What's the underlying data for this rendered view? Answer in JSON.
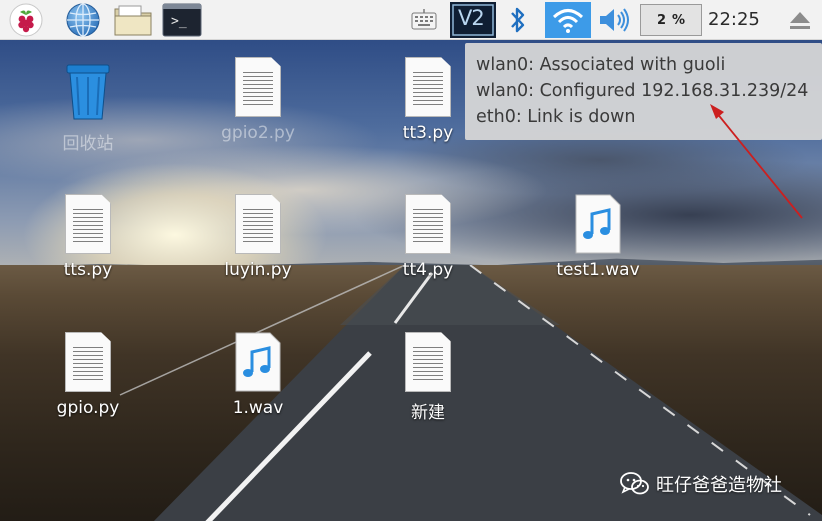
{
  "panel": {
    "menu_icon": "raspberry-icon",
    "browser_icon": "globe-icon",
    "files_icon": "folder-icon",
    "terminal_icon": "terminal-icon",
    "terminal_prompt": ">_",
    "keyboard_icon": "keyboard-icon",
    "vnc_icon": "vnc-icon",
    "vnc_label": "V2",
    "bluetooth_icon": "bluetooth-icon",
    "wifi_icon": "wifi-icon",
    "volume_icon": "speaker-icon",
    "cpu_value": "2",
    "cpu_unit": "%",
    "clock": "22:25",
    "eject_icon": "eject-icon"
  },
  "network_tooltip": {
    "lines": [
      "wlan0: Associated with guoli",
      "wlan0: Configured 192.168.31.239/24",
      "eth0: Link is down"
    ]
  },
  "desktop_icons": [
    {
      "label": "回收站",
      "type": "trash",
      "obscured": true
    },
    {
      "label": "gpio2.py",
      "type": "python-file",
      "obscured": true
    },
    {
      "label": "tt3.py",
      "type": "python-file",
      "obscured": false
    },
    {
      "label": "tts.py",
      "type": "python-file",
      "obscured": false
    },
    {
      "label": "luyin.py",
      "type": "python-file",
      "obscured": false
    },
    {
      "label": "tt4.py",
      "type": "python-file",
      "obscured": false
    },
    {
      "label": "test1.wav",
      "type": "audio-file",
      "obscured": false
    },
    {
      "label": "gpio.py",
      "type": "python-file",
      "obscured": false
    },
    {
      "label": "1.wav",
      "type": "audio-file",
      "obscured": false
    },
    {
      "label": "新建",
      "type": "python-file",
      "obscured": false
    }
  ],
  "watermark": {
    "icon": "wechat-icon",
    "text": "旺仔爸爸造物社"
  },
  "colors": {
    "panel_bg": "#f2f2f2",
    "wifi_active_bg": "#3d9be8",
    "vnc_bg": "#0f1e33",
    "annotation_arrow": "#cc1f1f"
  }
}
